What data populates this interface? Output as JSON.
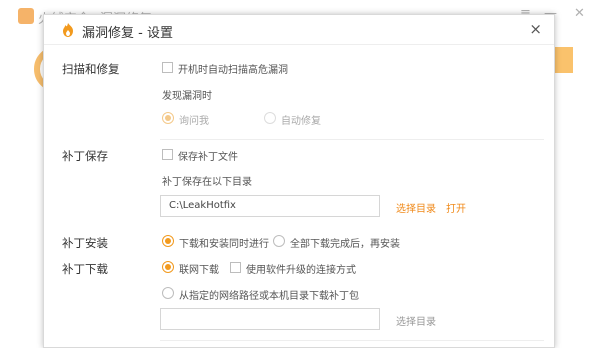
{
  "background": {
    "title_part1": "火绒安全",
    "title_part2": "漏洞修复"
  },
  "dialog": {
    "title": "漏洞修复 - 设置",
    "close_icon": "×"
  },
  "scan": {
    "label": "扫描和修复",
    "auto_scan_label": "开机时自动扫描高危漏洞",
    "found_label": "发现漏洞时",
    "ask_me": "询问我",
    "auto_fix": "自动修复"
  },
  "patch_save": {
    "label": "补丁保存",
    "save_label": "保存补丁文件",
    "dir_label": "补丁保存在以下目录",
    "dir_value": "C:\\LeakHotfix",
    "choose_dir": "选择目录",
    "open": "打开"
  },
  "patch_install": {
    "label": "补丁安装",
    "option1": "下载和安装同时进行",
    "option2": "全部下载完成后，再安装"
  },
  "patch_download": {
    "label": "补丁下载",
    "online": "联网下载",
    "upgrade_conn": "使用软件升级的连接方式",
    "from_path": "从指定的网络路径或本机目录下载补丁包",
    "path_value": "",
    "choose_dir": "选择目录"
  },
  "colors": {
    "accent": "#f29a1e",
    "link": "#f08a1a"
  }
}
